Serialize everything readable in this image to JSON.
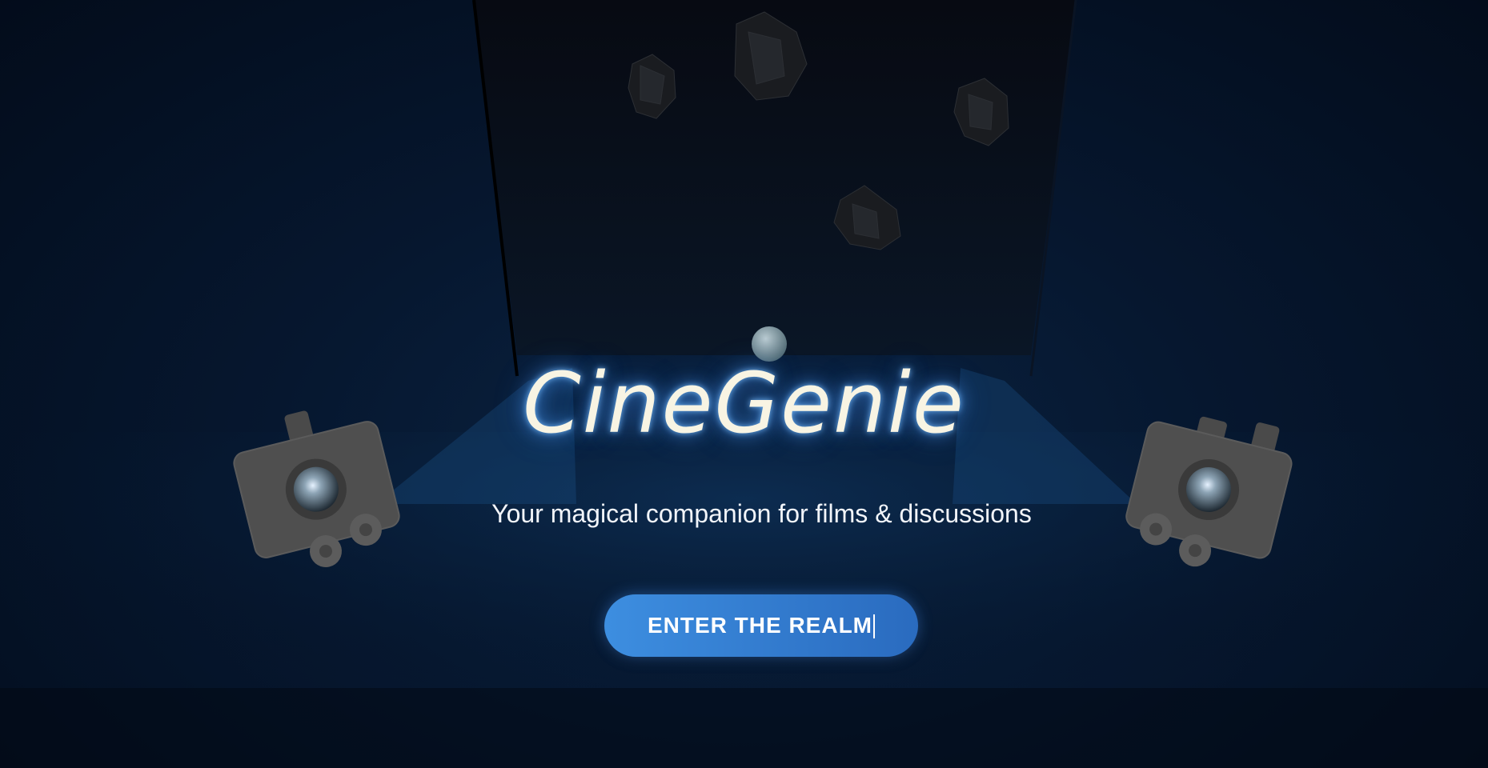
{
  "app": {
    "title": "CineGenie",
    "tagline": "Your magical companion for films & discussions"
  },
  "cta": {
    "label": "ENTER THE REALM"
  },
  "colors": {
    "background": "#051226",
    "title_glow": "#5aa0ff",
    "button": "#3d8ee0",
    "camera_body": "#4a4a4a"
  },
  "icons": {
    "left_camera": "film-camera-icon",
    "right_camera": "film-camera-icon",
    "orb": "orb-icon",
    "debris": "crystal-rock-icon"
  }
}
